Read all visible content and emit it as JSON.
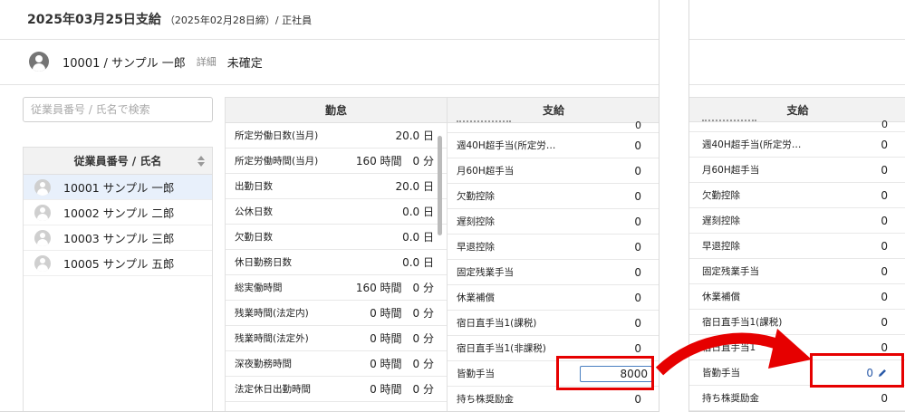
{
  "header": {
    "title_main": "2025年03月25日支給",
    "title_sub": "（2025年02月28日締）/ 正社員"
  },
  "employee_bar": {
    "name": "10001 / サンプル 一郎",
    "detail_link": "詳細",
    "status": "未確定"
  },
  "search": {
    "placeholder": "従業員番号 / 氏名で検索"
  },
  "employee_table": {
    "header": "従業員番号 / 氏名",
    "rows": [
      {
        "label": "10001  サンプル 一郎",
        "selected": true
      },
      {
        "label": "10002  サンプル 二郎",
        "selected": false
      },
      {
        "label": "10003  サンプル 三郎",
        "selected": false
      },
      {
        "label": "10005  サンプル 五郎",
        "selected": false
      }
    ]
  },
  "kintai": {
    "header": "勤怠",
    "rows": [
      {
        "label": "所定労働日数(当月)",
        "value": "20.0 日"
      },
      {
        "label": "所定労働時間(当月)",
        "value": "160 時間　0 分"
      },
      {
        "label": "出勤日数",
        "value": "20.0 日"
      },
      {
        "label": "公休日数",
        "value": "0.0 日"
      },
      {
        "label": "欠勤日数",
        "value": "0.0 日"
      },
      {
        "label": "休日勤務日数",
        "value": "0.0 日"
      },
      {
        "label": "総実働時間",
        "value": "160 時間　0 分"
      },
      {
        "label": "残業時間(法定内)",
        "value": "0 時間　0 分"
      },
      {
        "label": "残業時間(法定外)",
        "value": "0 時間　0 分"
      },
      {
        "label": "深夜勤務時間",
        "value": "0 時間　0 分"
      },
      {
        "label": "法定休日出勤時間",
        "value": "0 時間　0 分"
      },
      {
        "label": "",
        "value": ""
      }
    ]
  },
  "shikyu": {
    "header": "支給",
    "partial_value": "0",
    "rows": [
      {
        "label": "週40H超手当(所定労…",
        "value": "0"
      },
      {
        "label": "月60H超手当",
        "value": "0"
      },
      {
        "label": "欠勤控除",
        "value": "0"
      },
      {
        "label": "遅刻控除",
        "value": "0"
      },
      {
        "label": "早退控除",
        "value": "0"
      },
      {
        "label": "固定残業手当",
        "value": "0"
      },
      {
        "label": "休業補償",
        "value": "0"
      },
      {
        "label": "宿日直手当1(課税)",
        "value": "0"
      },
      {
        "label": "宿日直手当1(非課税)",
        "value": "0"
      },
      {
        "label": "皆勤手当",
        "value": "8000",
        "editing": true
      },
      {
        "label": "持ち株奨励金",
        "value": "0"
      }
    ]
  },
  "shikyu_after": {
    "header": "支給",
    "partial_value": "0",
    "rows": [
      {
        "label": "週40H超手当(所定労…",
        "value": "0"
      },
      {
        "label": "月60H超手当",
        "value": "0"
      },
      {
        "label": "欠勤控除",
        "value": "0"
      },
      {
        "label": "遅刻控除",
        "value": "0"
      },
      {
        "label": "早退控除",
        "value": "0"
      },
      {
        "label": "固定残業手当",
        "value": "0"
      },
      {
        "label": "休業補償",
        "value": "0"
      },
      {
        "label": "宿日直手当1(課税)",
        "value": "0"
      },
      {
        "label": "宿日直手当1",
        "value": "0"
      },
      {
        "label": "皆勤手当",
        "value": "0",
        "edited": true
      },
      {
        "label": "持ち株奨励金",
        "value": "0"
      }
    ]
  },
  "colors": {
    "highlight": "#e60000",
    "accent": "#2a5aa8",
    "selected_row": "#e8f0fb"
  }
}
